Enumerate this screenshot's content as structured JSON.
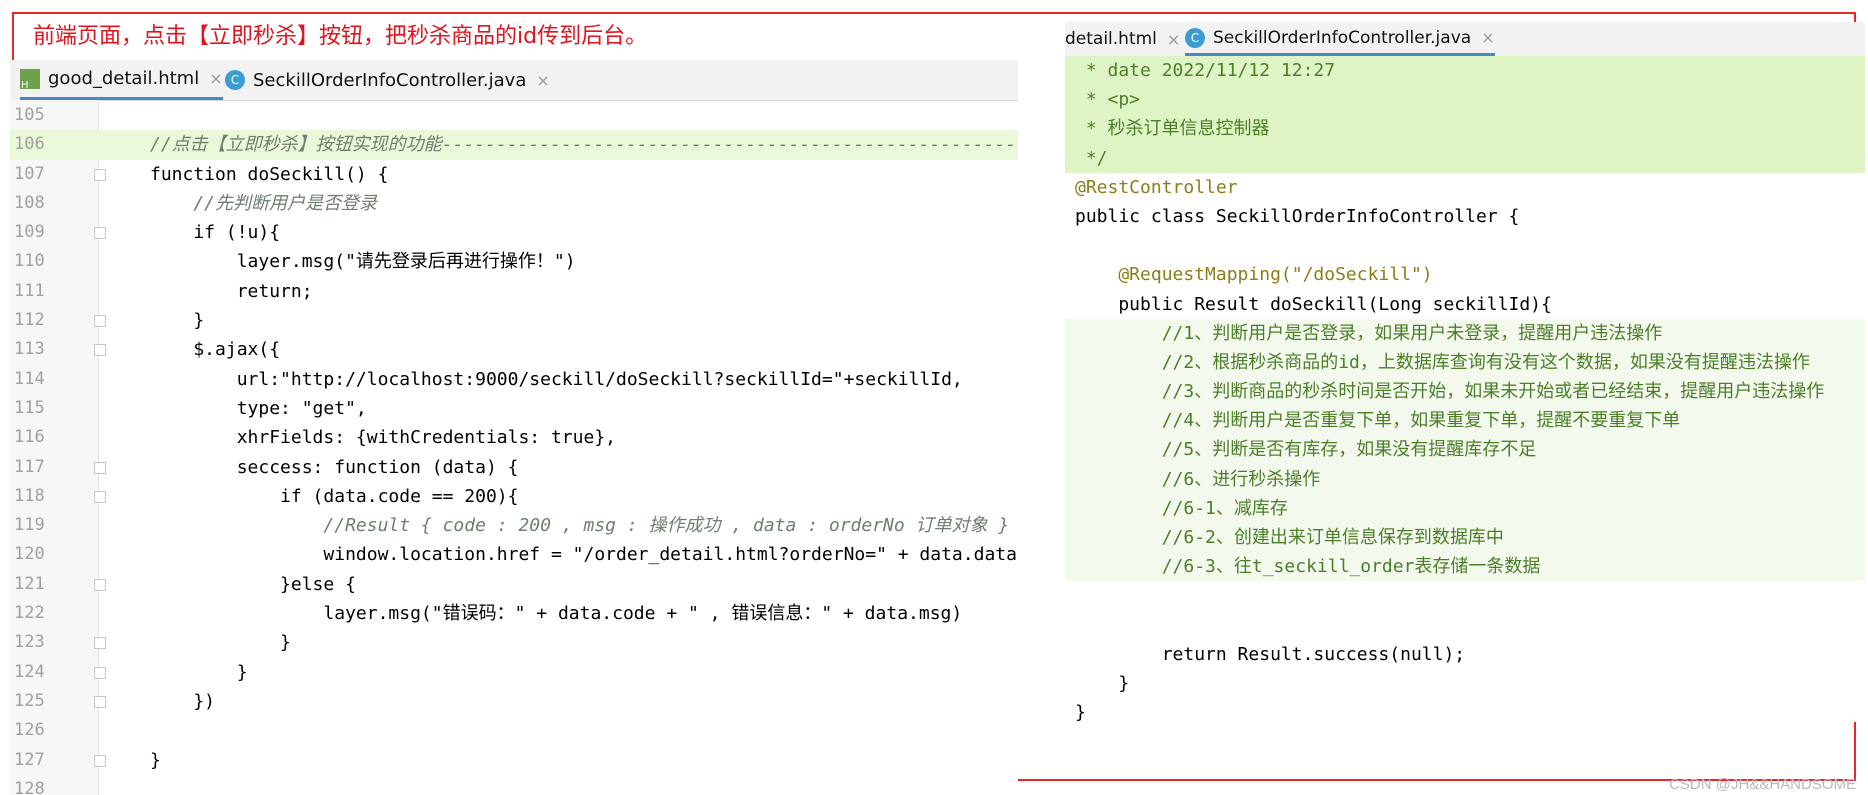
{
  "caption": "前端页面，点击【立即秒杀】按钮，把秒杀商品的id传到后台。",
  "watermark": "CSDN @JH&&HANDSOME",
  "left_tabs": [
    {
      "label": "good_detail.html",
      "close": "×",
      "icon": "html-file-icon"
    },
    {
      "label": "SeckillOrderInfoController.java",
      "close": "×",
      "icon": "java-class-icon"
    }
  ],
  "right_tabs": [
    {
      "label": "detail.html",
      "close": "×"
    },
    {
      "label": "SeckillOrderInfoController.java",
      "close": "×",
      "icon_letter": "C"
    }
  ],
  "left_lines": [
    {
      "num": "105",
      "code": ""
    },
    {
      "num": "106",
      "code": "//点击【立即秒杀】按钮实现的功能----------------------------------------------------------------------"
    },
    {
      "num": "107",
      "code": "function doSeckill() {"
    },
    {
      "num": "108",
      "code": "    //先判断用户是否登录"
    },
    {
      "num": "109",
      "code": "    if (!u){"
    },
    {
      "num": "110",
      "code": "        layer.msg(\"请先登录后再进行操作！\")"
    },
    {
      "num": "111",
      "code": "        return;"
    },
    {
      "num": "112",
      "code": "    }"
    },
    {
      "num": "113",
      "code": "    $.ajax({"
    },
    {
      "num": "114",
      "code": "        url:\"http://localhost:9000/seckill/doSeckill?seckillId=\"+seckillId,"
    },
    {
      "num": "115",
      "code": "        type: \"get\","
    },
    {
      "num": "116",
      "code": "        xhrFields: {withCredentials: true},"
    },
    {
      "num": "117",
      "code": "        seccess: function (data) {"
    },
    {
      "num": "118",
      "code": "            if (data.code == 200){"
    },
    {
      "num": "119",
      "code": "                //Result { code : 200 , msg : 操作成功 , data : orderNo 订单对象 }"
    },
    {
      "num": "120",
      "code": "                window.location.href = \"/order_detail.html?orderNo=\" + data.data;"
    },
    {
      "num": "121",
      "code": "            }else {"
    },
    {
      "num": "122",
      "code": "                layer.msg(\"错误码：\" + data.code + \" , 错误信息：\" + data.msg)"
    },
    {
      "num": "123",
      "code": "            }"
    },
    {
      "num": "124",
      "code": "        }"
    },
    {
      "num": "125",
      "code": "    })"
    },
    {
      "num": "126",
      "code": ""
    },
    {
      "num": "127",
      "code": "}"
    },
    {
      "num": "128",
      "code": ""
    }
  ],
  "right_lines": [
    " * date 2022/11/12 12:27",
    " * <p>",
    " * 秒杀订单信息控制器",
    " */",
    "@RestController",
    "public class SeckillOrderInfoController {",
    "",
    "    @RequestMapping(\"/doSeckill\")",
    "    public Result doSeckill(Long seckillId){",
    "        //1、判断用户是否登录，如果用户未登录，提醒用户违法操作",
    "        //2、根据秒杀商品的id，上数据库查询有没有这个数据，如果没有提醒违法操作",
    "        //3、判断商品的秒杀时间是否开始，如果未开始或者已经结束，提醒用户违法操作",
    "        //4、判断用户是否重复下单，如果重复下单，提醒不要重复下单",
    "        //5、判断是否有库存，如果没有提醒库存不足",
    "        //6、进行秒杀操作",
    "        //6-1、减库存",
    "        //6-2、创建出来订单信息保存到数据库中",
    "        //6-3、往t_seckill_order表存储一条数据",
    "",
    "",
    "        return Result.success(null);",
    "    }",
    "}"
  ]
}
